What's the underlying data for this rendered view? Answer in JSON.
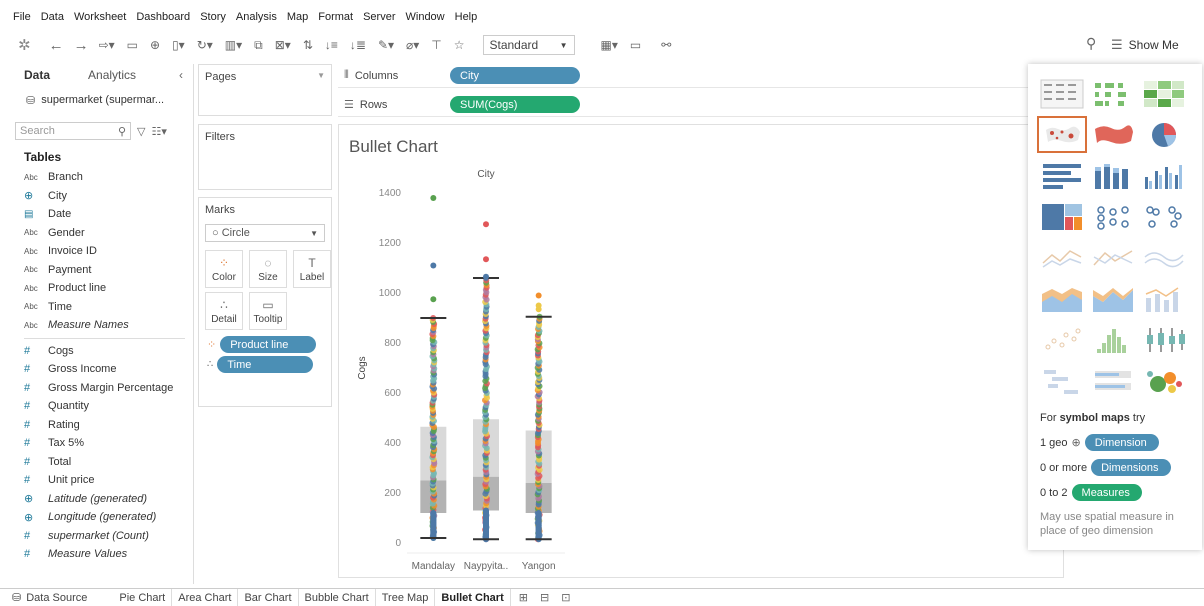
{
  "menu": [
    "File",
    "Data",
    "Worksheet",
    "Dashboard",
    "Story",
    "Analysis",
    "Map",
    "Format",
    "Server",
    "Window",
    "Help"
  ],
  "toolbar": {
    "fit_select": "Standard",
    "show_me_label": "Show Me"
  },
  "data_pane": {
    "tab_data": "Data",
    "tab_analytics": "Analytics",
    "datasource": "supermarket (supermar...",
    "search_placeholder": "Search",
    "tables_title": "Tables",
    "dimensions": [
      {
        "type": "Abc",
        "icon": "abc",
        "name": "Branch"
      },
      {
        "type": "geo",
        "icon": "geo",
        "name": "City"
      },
      {
        "type": "date",
        "icon": "date",
        "name": "Date"
      },
      {
        "type": "Abc",
        "icon": "abc",
        "name": "Gender"
      },
      {
        "type": "Abc",
        "icon": "abc",
        "name": "Invoice ID"
      },
      {
        "type": "Abc",
        "icon": "abc",
        "name": "Payment"
      },
      {
        "type": "Abc",
        "icon": "abc",
        "name": "Product line"
      },
      {
        "type": "Abc",
        "icon": "abc",
        "name": "Time"
      },
      {
        "type": "Abc",
        "icon": "abc",
        "name": "Measure Names",
        "italic": true
      }
    ],
    "measures": [
      {
        "icon": "num",
        "name": "Cogs"
      },
      {
        "icon": "num",
        "name": "Gross Income"
      },
      {
        "icon": "num",
        "name": "Gross Margin Percentage"
      },
      {
        "icon": "num",
        "name": "Quantity"
      },
      {
        "icon": "num",
        "name": "Rating"
      },
      {
        "icon": "num",
        "name": "Tax 5%"
      },
      {
        "icon": "num",
        "name": "Total"
      },
      {
        "icon": "num",
        "name": "Unit price"
      },
      {
        "icon": "geo",
        "name": "Latitude (generated)",
        "italic": true
      },
      {
        "icon": "geo",
        "name": "Longitude (generated)",
        "italic": true
      },
      {
        "icon": "num",
        "name": "supermarket (Count)",
        "italic": true
      },
      {
        "icon": "num",
        "name": "Measure Values",
        "italic": true
      }
    ]
  },
  "cards": {
    "pages": "Pages",
    "filters": "Filters",
    "marks": "Marks",
    "mark_type": "Circle",
    "mark_buttons": [
      "Color",
      "Size",
      "Label",
      "Detail",
      "Tooltip"
    ],
    "mark_pills": [
      "Product line",
      "Time"
    ]
  },
  "shelves": {
    "columns_label": "Columns",
    "columns_pill": "City",
    "rows_label": "Rows",
    "rows_pill": "SUM(Cogs)"
  },
  "viz": {
    "title": "Bullet Chart"
  },
  "chart_data": {
    "type": "scatter",
    "title": "Bullet Chart",
    "header": "City",
    "categories": [
      "Mandalay",
      "Naypyita..",
      "Yangon"
    ],
    "xlabel": "",
    "ylabel": "Cogs",
    "ylim": [
      0,
      1400
    ],
    "yticks": [
      0,
      200,
      400,
      600,
      800,
      1000,
      1200,
      1400
    ],
    "grid": false,
    "boxes": [
      {
        "category": "Mandalay",
        "min": 20,
        "q1": 120,
        "median": 250,
        "q3": 465,
        "max": 900
      },
      {
        "category": "Naypyita..",
        "min": 15,
        "q1": 130,
        "median": 265,
        "q3": 495,
        "max": 1060
      },
      {
        "category": "Yangon",
        "min": 15,
        "q1": 120,
        "median": 240,
        "q3": 450,
        "max": 905
      }
    ],
    "outliers": [
      {
        "category": "Mandalay",
        "values": [
          1380,
          1110,
          975
        ]
      },
      {
        "category": "Naypyita..",
        "values": [
          1275,
          1135,
          1065
        ]
      },
      {
        "category": "Yangon",
        "values": [
          990,
          950,
          935
        ]
      }
    ],
    "point_colors": [
      "#4e79a7",
      "#f28e2b",
      "#e15759",
      "#76b7b2",
      "#59a14f",
      "#edc948",
      "#b07aa1"
    ]
  },
  "show_me": {
    "hint_prefix": "For ",
    "hint_bold": "symbol maps",
    "hint_suffix": " try",
    "row1_prefix": "1 geo",
    "row1_pill": "Dimension",
    "row2_prefix": "0 or more",
    "row2_pill": "Dimensions",
    "row3_prefix": "0 to 2",
    "row3_pill": "Measures",
    "note": "May use spatial measure in place of geo dimension"
  },
  "sheet_tabs": {
    "data_source": "Data Source",
    "tabs": [
      "Pie Chart",
      "Area Chart",
      "Bar Chart",
      "Bubble Chart",
      "Tree Map",
      "Bullet Chart"
    ],
    "active": "Bullet Chart"
  }
}
